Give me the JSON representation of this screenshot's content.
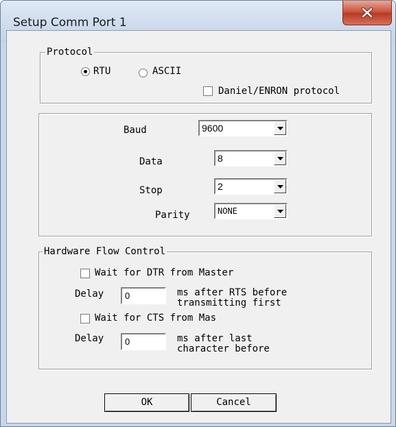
{
  "window": {
    "title": "Setup Comm Port 1"
  },
  "protocol": {
    "legend": "Protocol",
    "rtu_label": "RTU",
    "ascii_label": "ASCII",
    "selected": "RTU",
    "daniel_label": "Daniel/ENRON protocol",
    "daniel_checked": false
  },
  "serial": {
    "baud_label": "Baud",
    "baud_value": "9600",
    "data_label": "Data",
    "data_value": "8",
    "stop_label": "Stop",
    "stop_value": "2",
    "parity_label": "Parity",
    "parity_value": "NONE"
  },
  "flow": {
    "legend": "Hardware Flow Control",
    "dtr_label": "Wait for DTR from Master",
    "dtr_checked": false,
    "delay1_label": "Delay",
    "delay1_value": "0",
    "delay1_desc_line1": "ms after RTS before",
    "delay1_desc_line2": "transmitting first",
    "cts_label": "Wait for CTS from Mas",
    "cts_checked": false,
    "delay2_label": "Delay",
    "delay2_value": "0",
    "delay2_desc_line1": "ms after last",
    "delay2_desc_line2": "character before"
  },
  "buttons": {
    "ok": "OK",
    "cancel": "Cancel"
  },
  "icons": {
    "close": "close-x-icon",
    "dropdown": "chevron-down-icon"
  }
}
